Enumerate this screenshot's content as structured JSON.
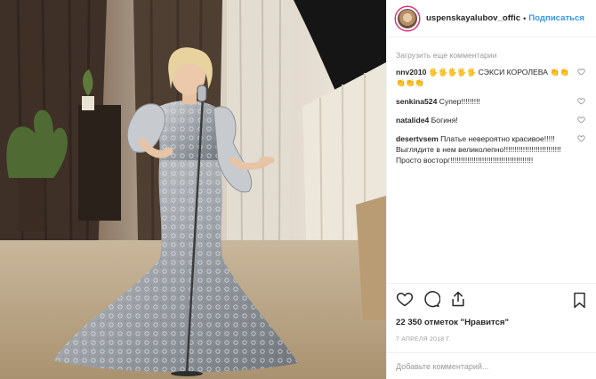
{
  "header": {
    "username": "uspenskayalubov_offic",
    "separator": "•",
    "follow_label": "Подписаться"
  },
  "comments": {
    "load_more": "Загрузить еще комментарии",
    "items": [
      {
        "user": "nnv2010",
        "text": "🖐🖐🖐🖐🖐 СЭКСИ КОРОЛЕВА 👏👏👏👏👏"
      },
      {
        "user": "senkina524",
        "text": "Супер!!!!!!!!!"
      },
      {
        "user": "natalide4",
        "text": "Богиня!"
      },
      {
        "user": "desertvsem",
        "text": "Платье невероятно красивое!!!!! Выглядите в нем великолепно!!!!!!!!!!!!!!!!!!!!!!!!!!! Просто восторг!!!!!!!!!!!!!!!!!!!!!!!!!!!!!!!!!!!!!!!"
      }
    ]
  },
  "actions": {
    "like_icon": "heart-outline-icon",
    "comment_icon": "comment-bubble-icon",
    "share_icon": "share-icon",
    "save_icon": "bookmark-icon"
  },
  "likes_text": "22 350 отметок \"Нравится\"",
  "date_text": "7 АПРЕЛЯ 2018 Г.",
  "add_comment": {
    "placeholder": "Добавьте комментарий..."
  },
  "colors": {
    "accent": "#3897f0",
    "muted": "#999999",
    "text": "#262626"
  }
}
